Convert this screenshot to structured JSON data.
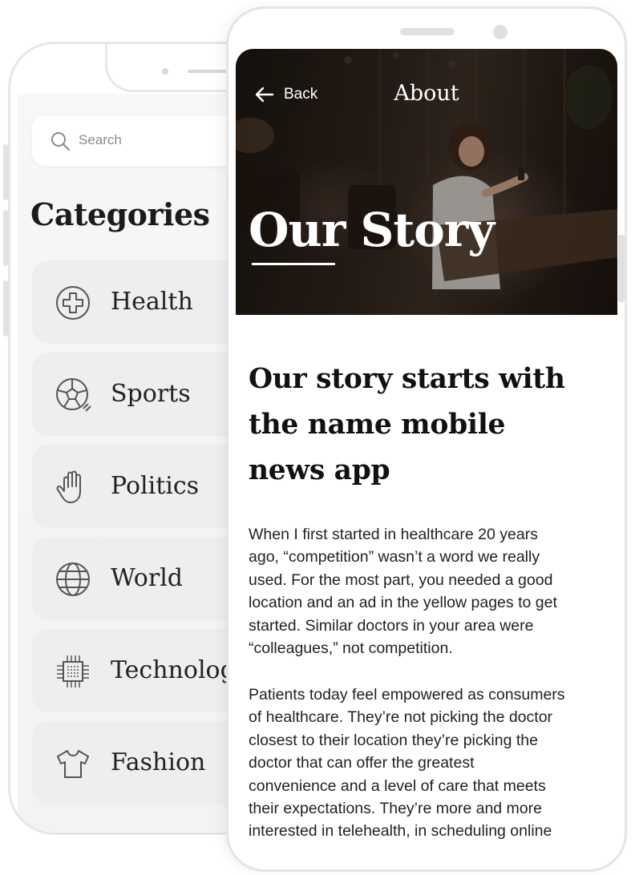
{
  "back_screen": {
    "search": {
      "placeholder": "Search"
    },
    "categories_title": "Categories",
    "categories": [
      {
        "label": "Health",
        "icon": "plus-circle-icon"
      },
      {
        "label": "Sports",
        "icon": "soccer-ball-icon"
      },
      {
        "label": "Politics",
        "icon": "raised-hand-icon"
      },
      {
        "label": "World",
        "icon": "globe-icon"
      },
      {
        "label": "Technology",
        "icon": "chip-icon"
      },
      {
        "label": "Fashion",
        "icon": "tshirt-icon"
      }
    ]
  },
  "front_screen": {
    "nav": {
      "back_label": "Back",
      "title": "About"
    },
    "hero_title": "Our Story",
    "heading": "Our story starts with\nthe name mobile\nnews app",
    "paragraphs": [
      "When I first started in healthcare 20 years\nago, “competition” wasn’t a word we really\nused. For the most part, you needed a good\nlocation and an ad in the yellow pages to get\nstarted. Similar doctors in your area were\n“colleagues,” not competition.",
      "Patients today feel empowered as consumers\nof healthcare. They’re not picking the doctor\nclosest to their location they’re picking the\ndoctor that can offer the greatest\nconvenience and a level of care that meets\ntheir expectations. They’re more and more\ninterested in telehealth, in scheduling online"
    ]
  },
  "colors": {
    "card_bg": "#eeeeee",
    "text_dark": "#111111",
    "phone_frame": "#e4e4e4"
  }
}
